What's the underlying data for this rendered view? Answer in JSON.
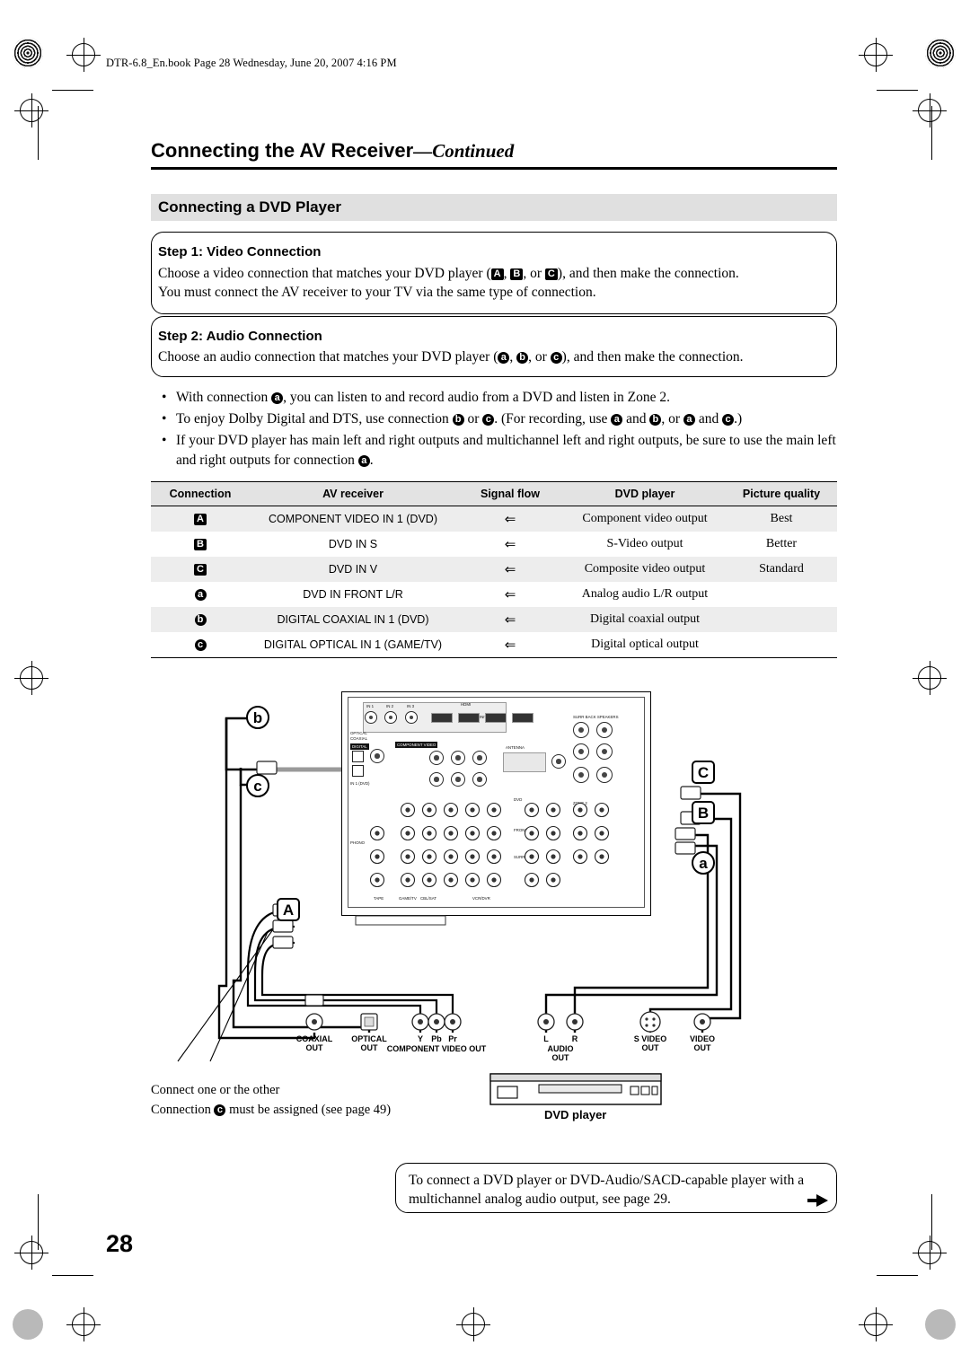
{
  "header": {
    "filebar": "DTR-6.8_En.book  Page 28  Wednesday, June 20, 2007  4:16 PM",
    "title_main": "Connecting the AV Receiver",
    "title_dash": "—",
    "title_cont": "Continued",
    "section": "Connecting a DVD Player"
  },
  "steps": [
    {
      "heading": "Step 1: Video Connection",
      "line1_pre": "Choose a video connection that matches your DVD player (",
      "badges": [
        "A",
        "B",
        "C"
      ],
      "line1_post": "), and then make the connection.",
      "line2": "You must connect the AV receiver to your TV via the same type of connection."
    },
    {
      "heading": "Step 2: Audio Connection",
      "line1_pre": "Choose an audio connection that matches your DVD player (",
      "badges": [
        "a",
        "b",
        "c"
      ],
      "line1_post": "), and then make the connection."
    }
  ],
  "bullets": [
    {
      "parts": [
        "With connection ",
        "a",
        ", you can listen to and record audio from a DVD and listen in Zone 2."
      ]
    },
    {
      "parts": [
        "To enjoy Dolby Digital and DTS, use connection ",
        "b",
        " or ",
        "c",
        ". (For recording, use ",
        "a",
        " and ",
        "b",
        ", or ",
        "a",
        " and ",
        "c",
        ".)"
      ]
    },
    {
      "parts": [
        "If your DVD player has main left and right outputs and multichannel left and right outputs, be sure to use the main left and right outputs for connection ",
        "a",
        "."
      ]
    }
  ],
  "table": {
    "headers": [
      "Connection",
      "AV receiver",
      "Signal flow",
      "DVD player",
      "Picture quality"
    ],
    "rows": [
      {
        "conn": "A",
        "type": "upper",
        "receiver": "COMPONENT VIDEO IN 1 (DVD)",
        "flow": "⇐",
        "dvd": "Component video output",
        "quality": "Best",
        "shaded": true
      },
      {
        "conn": "B",
        "type": "upper",
        "receiver": "DVD IN S",
        "flow": "⇐",
        "dvd": "S-Video output",
        "quality": "Better",
        "shaded": false
      },
      {
        "conn": "C",
        "type": "upper",
        "receiver": "DVD IN V",
        "flow": "⇐",
        "dvd": "Composite video output",
        "quality": "Standard",
        "shaded": true
      },
      {
        "conn": "a",
        "type": "lower",
        "receiver": "DVD IN FRONT L/R",
        "flow": "⇐",
        "dvd": "Analog audio L/R output",
        "quality": "",
        "shaded": false
      },
      {
        "conn": "b",
        "type": "lower",
        "receiver": "DIGITAL COAXIAL IN 1 (DVD)",
        "flow": "⇐",
        "dvd": "Digital coaxial output",
        "quality": "",
        "shaded": true
      },
      {
        "conn": "c",
        "type": "lower",
        "receiver": "DIGITAL OPTICAL IN 1 (GAME/TV)",
        "flow": "⇐",
        "dvd": "Digital optical output",
        "quality": "",
        "shaded": false
      }
    ]
  },
  "diagram": {
    "badges": {
      "b": "b",
      "c": "c",
      "a_left": "A",
      "C": "C",
      "B": "B",
      "a_right": "a"
    },
    "dvd_player_label": "DVD player",
    "jack_labels": [
      {
        "l1": "COAXIAL",
        "l2": "OUT"
      },
      {
        "l1": "OPTICAL",
        "l2": "OUT"
      },
      {
        "l1": "COMPONENT VIDEO OUT",
        "l2": ""
      },
      {
        "l1": "AUDIO",
        "l2": "OUT"
      },
      {
        "l1": "S VIDEO",
        "l2": "OUT"
      },
      {
        "l1": "VIDEO",
        "l2": "OUT"
      }
    ],
    "component_ticks": [
      "Y",
      "Pb",
      "Pr"
    ],
    "audio_ticks": [
      "L",
      "R"
    ],
    "audio_tick_mid": "AUDIO",
    "notes": {
      "note1": "Connect one or the other",
      "note2_pre": "Connection ",
      "note2_badge": "c",
      "note2_post": " must be assigned (see page 49)"
    },
    "receiver_labels": {
      "digital": "DIGITAL",
      "optical": "OPTICAL",
      "coaxial": "COAXIAL",
      "component_video": "COMPONENT VIDEO",
      "antenna": "ANTENNA",
      "monitor_out": "MONITOR OUT",
      "hdmi": "HDMI",
      "in1": "IN 1",
      "in2": "IN 2",
      "in3": "IN 3",
      "dvd": "DVD",
      "front": "FRONT",
      "phono": "PHONO",
      "surround": "SURROUND",
      "surr_back": "SURR BACK",
      "cbl_sat": "CBL/SAT",
      "vcr_dvr": "VCR/DVR",
      "game_tv": "GAME/TV",
      "tape": "TAPE",
      "zone2": "ZONE 2",
      "in_1_dvd": "IN 1 (DVD)",
      "speakers": "SURR BACK SPEAKERS"
    }
  },
  "callout": {
    "line1": "To connect a DVD player or DVD-Audio/SACD-capable player with a",
    "line2": "multichannel analog audio output, see page 29."
  },
  "page_number": "28"
}
